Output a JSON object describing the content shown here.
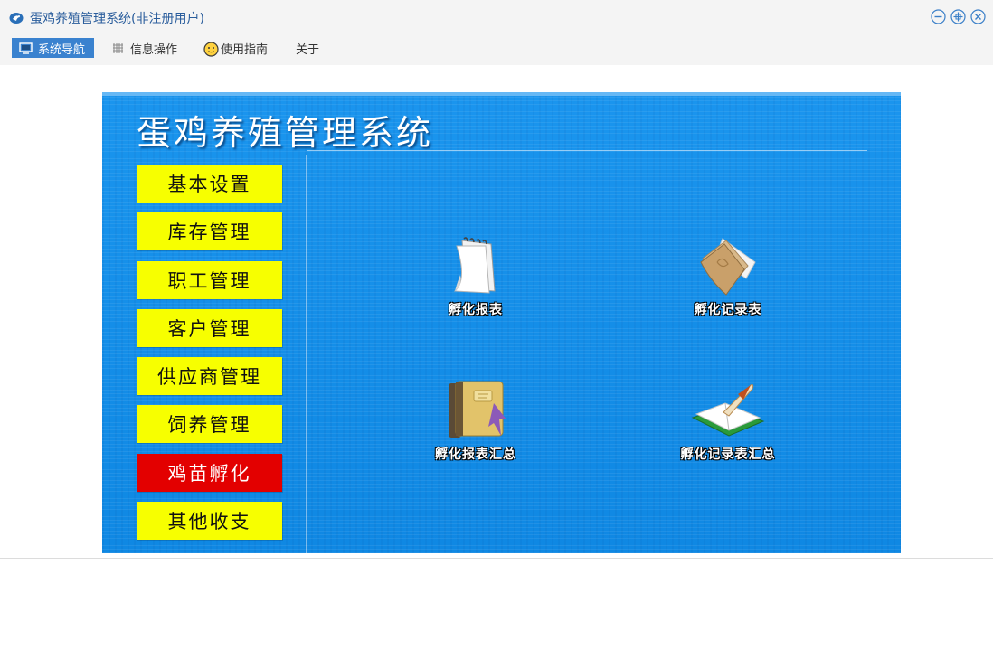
{
  "window": {
    "title": "蛋鸡养殖管理系统(非注册用户)"
  },
  "menu": {
    "items": [
      {
        "label": "系统导航",
        "icon": "monitor-icon",
        "active": true
      },
      {
        "label": "信息操作",
        "icon": "grid-icon",
        "active": false
      },
      {
        "label": "使用指南",
        "icon": "smiley-icon",
        "active": false
      },
      {
        "label": "关于",
        "icon": "",
        "active": false
      }
    ]
  },
  "banner": {
    "title": "蛋鸡养殖管理系统"
  },
  "nav": {
    "items": [
      {
        "label": "基本设置",
        "active": false
      },
      {
        "label": "库存管理",
        "active": false
      },
      {
        "label": "职工管理",
        "active": false
      },
      {
        "label": "客户管理",
        "active": false
      },
      {
        "label": "供应商管理",
        "active": false
      },
      {
        "label": "饲养管理",
        "active": false
      },
      {
        "label": "鸡苗孵化",
        "active": true
      },
      {
        "label": "其他收支",
        "active": false
      }
    ]
  },
  "reports": {
    "items": [
      {
        "label": "孵化报表",
        "icon": "notepad-icon"
      },
      {
        "label": "孵化记录表",
        "icon": "folder-icon"
      },
      {
        "label": "孵化报表汇总",
        "icon": "notebook-icon"
      },
      {
        "label": "孵化记录表汇总",
        "icon": "open-book-quill-icon"
      }
    ]
  },
  "colors": {
    "accent": "#3a82cf",
    "canvas": "#1490ea",
    "nav_button": "#f7ff00",
    "nav_active": "#e30000",
    "title_text": "#2a5d9c"
  }
}
